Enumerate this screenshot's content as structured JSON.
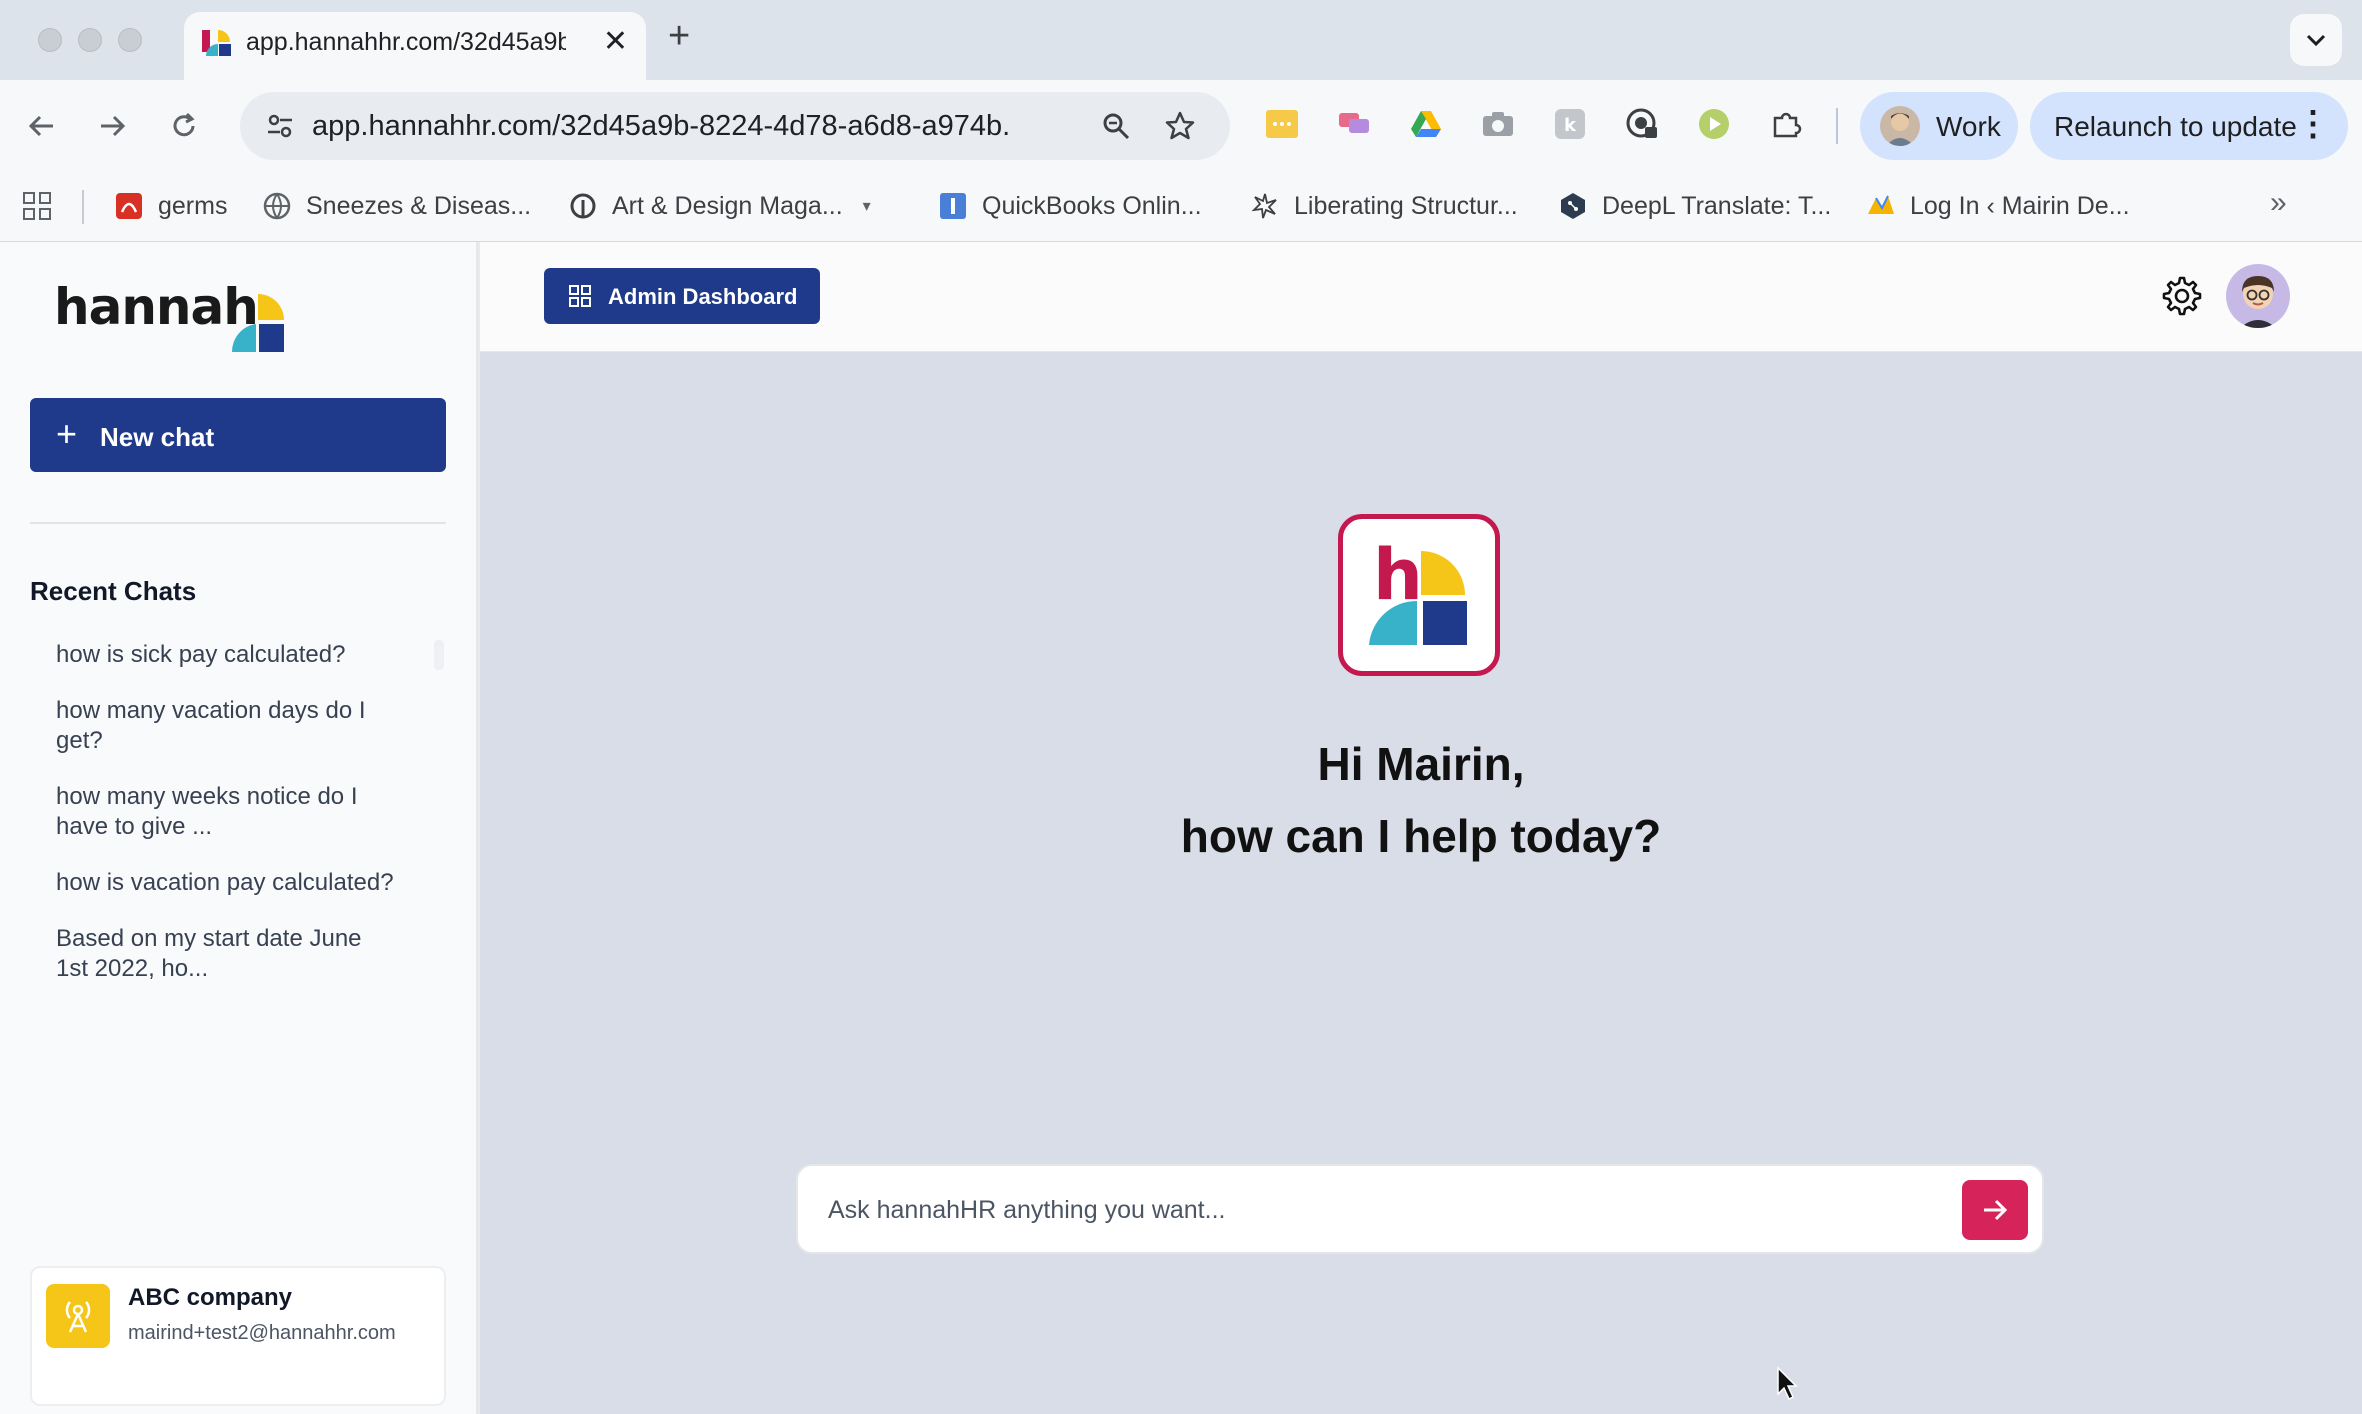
{
  "browser": {
    "tab_title": "app.hannahhr.com/32d45a9b",
    "url": "app.hannahhr.com/32d45a9b-8224-4d78-a6d8-a974b...",
    "profile_label": "Work",
    "relaunch_label": "Relaunch to update",
    "bookmarks": [
      {
        "label": "germs",
        "icon": "pdf-icon"
      },
      {
        "label": "Sneezes & Diseas...",
        "icon": "globe-icon"
      },
      {
        "label": "Art & Design Maga...",
        "icon": "site-icon"
      },
      {
        "label": "QuickBooks Onlin...",
        "icon": "quickbooks-icon"
      },
      {
        "label": "Liberating Structur...",
        "icon": "star-burst-icon"
      },
      {
        "label": "DeepL Translate: T...",
        "icon": "deepl-icon"
      },
      {
        "label": "Log In ‹ Mairin De...",
        "icon": "wordpress-icon"
      }
    ]
  },
  "sidebar": {
    "new_chat_label": "New chat",
    "recent_title": "Recent Chats",
    "recent_chats": [
      "how is sick pay calculated?",
      "how many vacation days do I get?",
      "how many weeks notice do I have to give ...",
      "how is vacation pay calculated?",
      "Based on my start date June 1st 2022, ho..."
    ],
    "company": {
      "name": "ABC company",
      "email": "mairind+test2@hannahhr.com"
    }
  },
  "header": {
    "admin_label": "Admin Dashboard"
  },
  "main": {
    "greeting_line1": "Hi Mairin,",
    "greeting_line2": "how can I help today?",
    "input_placeholder": "Ask hannahHR anything you want..."
  },
  "colors": {
    "brand_navy": "#1f3a8a",
    "brand_red": "#d6245a",
    "brand_yellow": "#f5c518",
    "brand_teal": "#38b2c8"
  }
}
